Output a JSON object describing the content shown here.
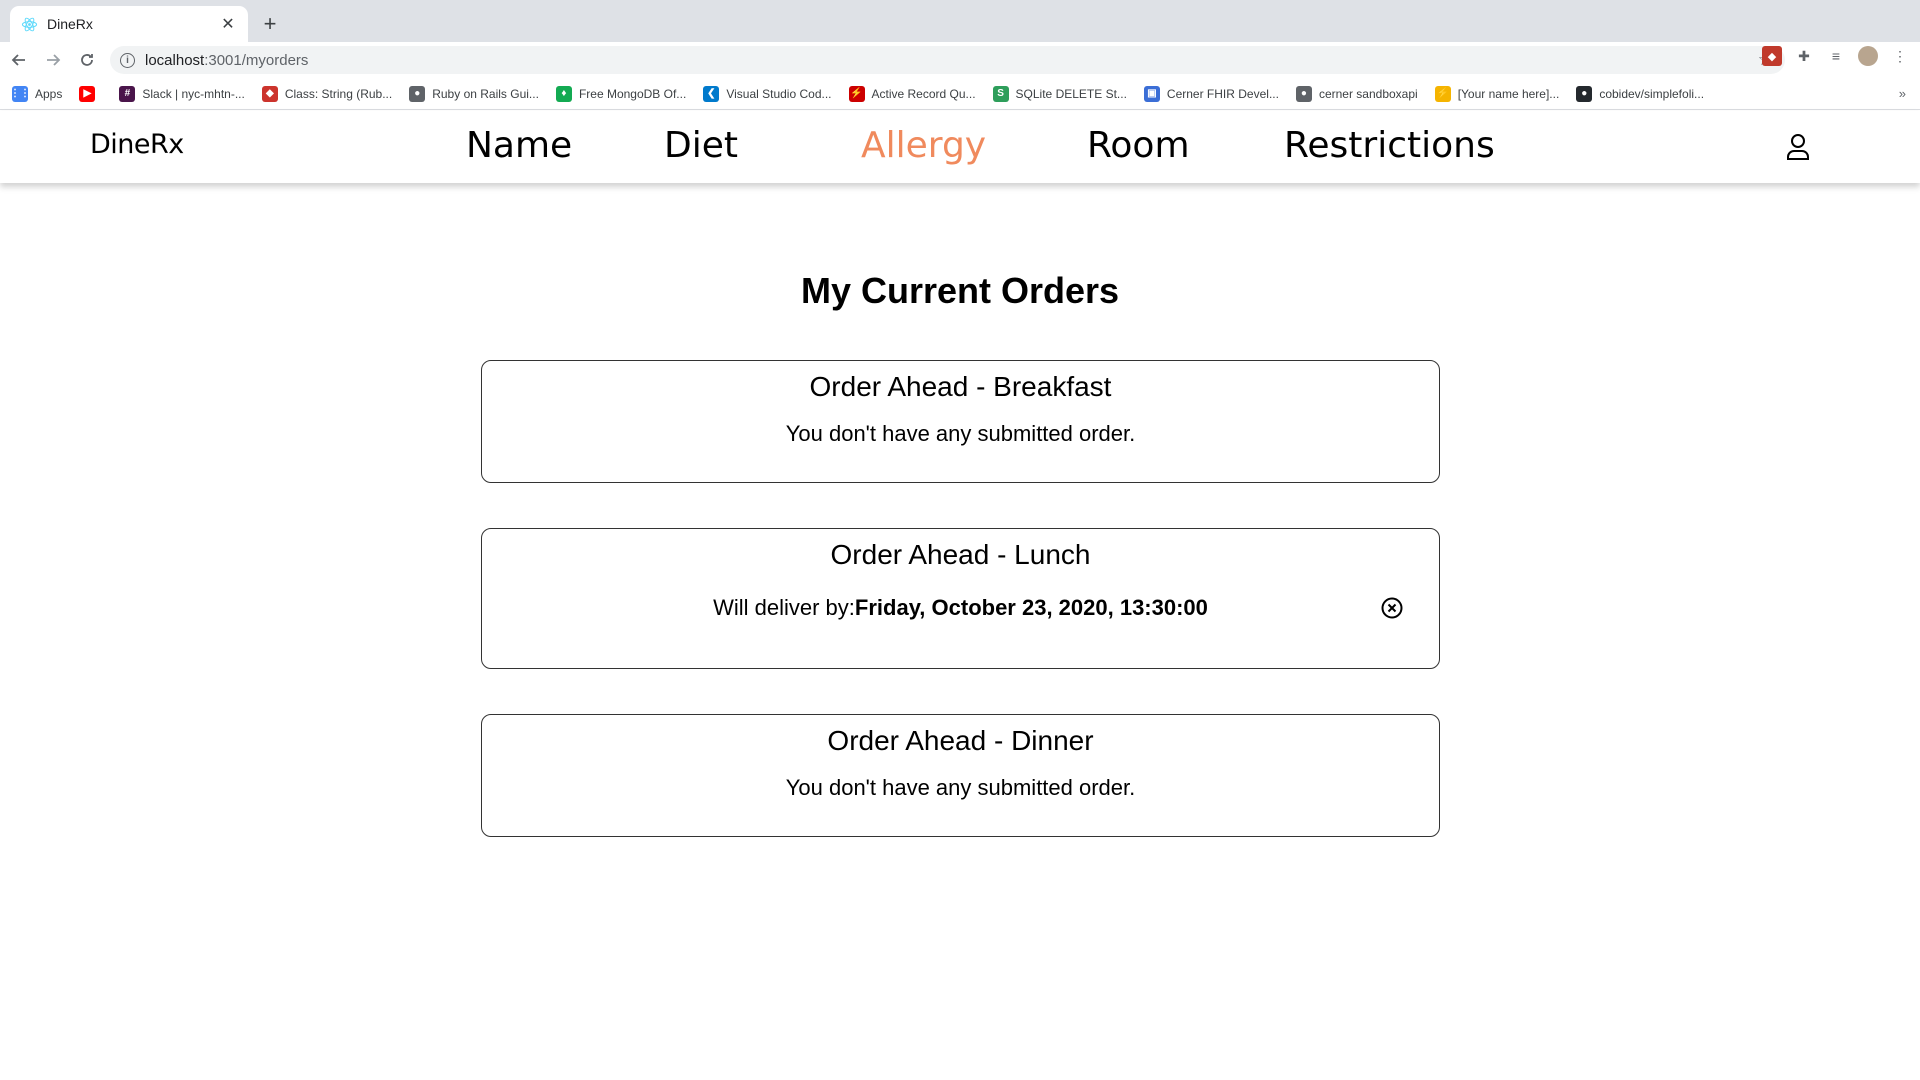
{
  "browser": {
    "tab_title": "DineRx",
    "url_host": "localhost",
    "url_path": ":3001/myorders",
    "bookmarks": [
      {
        "label": "Apps",
        "icon": "apps-grid-icon",
        "color": "#4285f4"
      },
      {
        "label": "",
        "icon": "youtube-icon",
        "color": "#ff0000"
      },
      {
        "label": "Slack | nyc-mhtn-...",
        "icon": "slack-icon",
        "color": "#4a154b"
      },
      {
        "label": "Class: String (Rub...",
        "icon": "ruby-icon",
        "color": "#cc342d"
      },
      {
        "label": "Ruby on Rails Gui...",
        "icon": "globe-icon",
        "color": "#5f6368"
      },
      {
        "label": "Free MongoDB Of...",
        "icon": "mongodb-icon",
        "color": "#13aa52"
      },
      {
        "label": "Visual Studio Cod...",
        "icon": "vscode-icon",
        "color": "#007acc"
      },
      {
        "label": "Active Record Qu...",
        "icon": "rails-icon",
        "color": "#cc0000"
      },
      {
        "label": "SQLite DELETE St...",
        "icon": "sqlite-icon",
        "color": "#2e9e5b"
      },
      {
        "label": "Cerner FHIR Devel...",
        "icon": "cerner-icon",
        "color": "#3b6ed6"
      },
      {
        "label": "cerner sandboxapi",
        "icon": "globe-icon",
        "color": "#5f6368"
      },
      {
        "label": "[Your name here]...",
        "icon": "lightning-icon",
        "color": "#f5b400"
      },
      {
        "label": "cobidev/simplefoli...",
        "icon": "github-icon",
        "color": "#24292e"
      }
    ]
  },
  "app": {
    "brand": "DineRx",
    "nav": [
      {
        "label": "Name",
        "active": false
      },
      {
        "label": "Diet",
        "active": false
      },
      {
        "label": "Allergy",
        "active": true
      },
      {
        "label": "Room",
        "active": false
      },
      {
        "label": "Restrictions",
        "active": false
      }
    ],
    "accent_color": "#f08a5d"
  },
  "page": {
    "title": "My Current Orders",
    "orders": [
      {
        "title": "Order Ahead - Breakfast",
        "message": "You don't have any submitted order."
      },
      {
        "title": "Order Ahead - Lunch",
        "deliver_prefix": "Will deliver by:",
        "deliver_time": "Friday, October 23, 2020, 13:30:00"
      },
      {
        "title": "Order Ahead - Dinner",
        "message": "You don't have any submitted order."
      }
    ]
  }
}
